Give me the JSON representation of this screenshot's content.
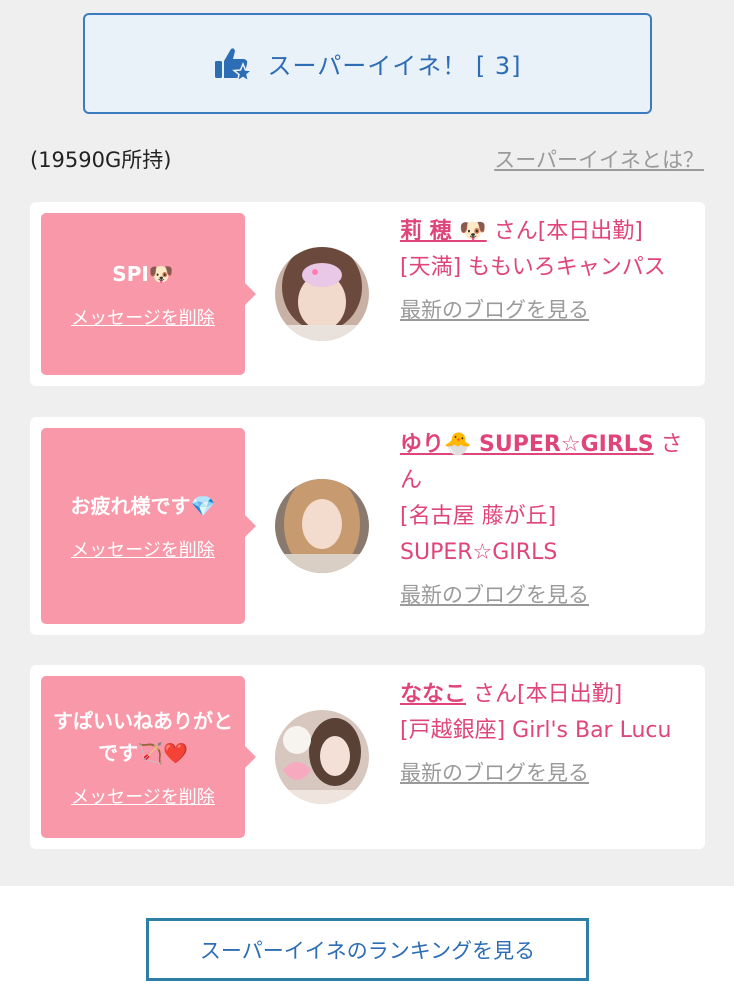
{
  "header": {
    "super_like_label": "スーパーイイネ！ [ 3]"
  },
  "owned_text": "(19590G所持)",
  "about_link": "スーパーイイネとは？",
  "cards": [
    {
      "message": "SPI🐶",
      "delete_label": "メッセージを削除",
      "name": "莉 穂 🐶",
      "san": " さん",
      "status": "[本日出勤]",
      "shop": "[天満] ももいろキャンパス",
      "blog_link": "最新のブログを見る"
    },
    {
      "message": "お疲れ様です💎",
      "delete_label": "メッセージを削除",
      "name": "ゆり🐣 SUPER☆GIRLS",
      "san": " さん",
      "status": "",
      "shop": "[名古屋 藤が丘] SUPER☆GIRLS",
      "blog_link": "最新のブログを見る"
    },
    {
      "message": "すぱいいねありがとです🏹❤️",
      "delete_label": "メッセージを削除",
      "name": "ななこ",
      "san": " さん",
      "status": "[本日出勤]",
      "shop": "[戸越銀座] Girl's Bar Lucu",
      "blog_link": "最新のブログを見る"
    }
  ],
  "ranking_button": "スーパーイイネのランキングを見る",
  "colors": {
    "accent_blue": "#2d6db5",
    "pink": "#f898a8",
    "name_pink": "#e0457a"
  }
}
